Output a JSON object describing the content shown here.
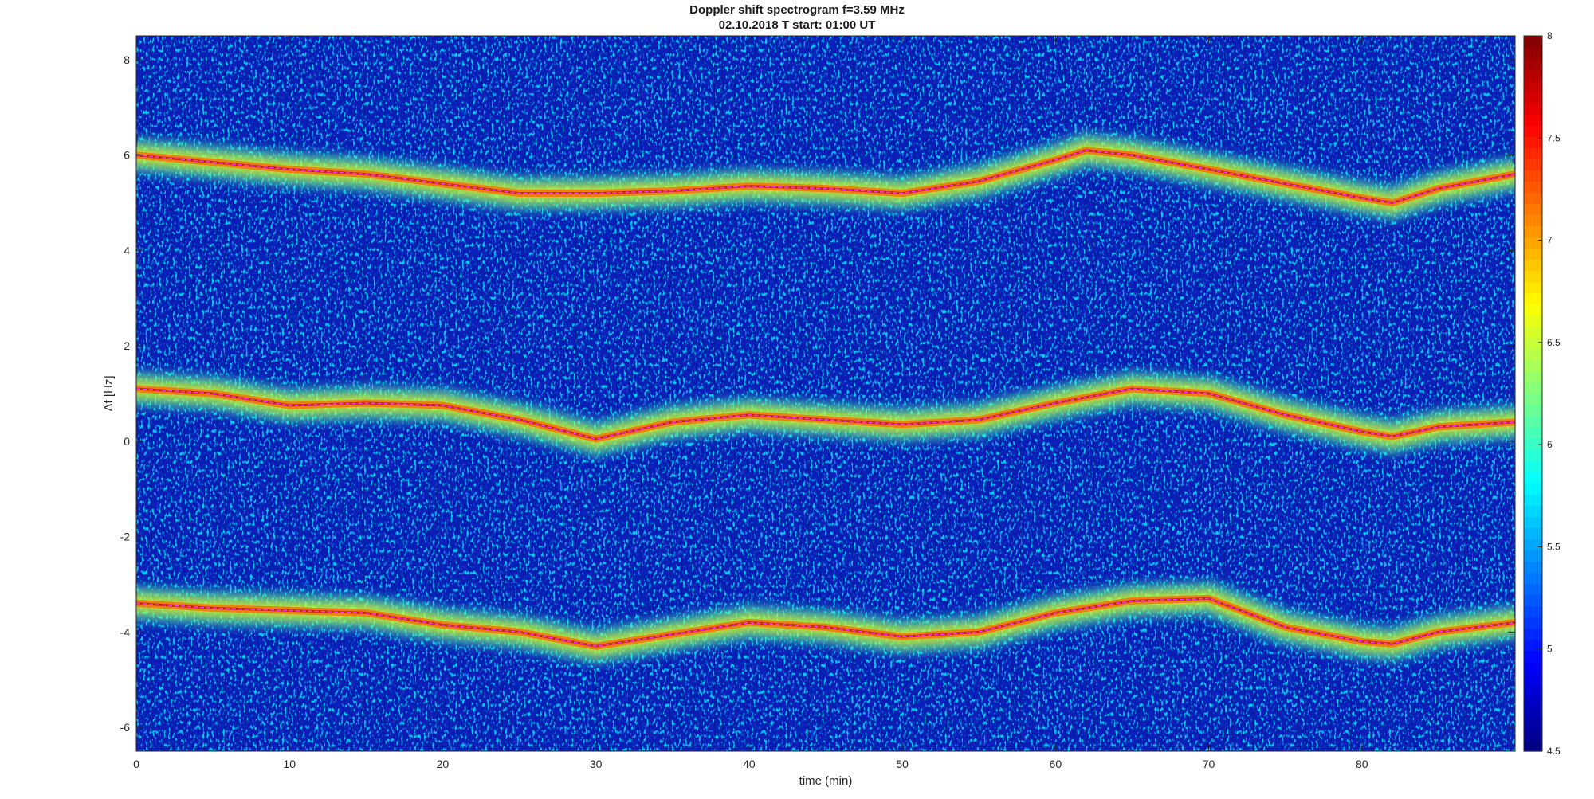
{
  "chart_data": {
    "type": "heatmap",
    "title": "Doppler shift spectrogram f=3.59 MHz",
    "subtitle": "02.10.2018   T start: 01:00 UT",
    "xlabel": "time (min)",
    "ylabel": "Δf [Hz]",
    "xlim": [
      0,
      90
    ],
    "ylim": [
      -6.5,
      8.5
    ],
    "xticks": [
      0,
      10,
      20,
      30,
      40,
      50,
      60,
      70,
      80
    ],
    "yticks": [
      -6,
      -4,
      -2,
      0,
      2,
      4,
      6,
      8
    ],
    "colormap": "jet",
    "clim": [
      4.5,
      8
    ],
    "colorbar_ticks": [
      4.5,
      5,
      5.5,
      6,
      6.5,
      7,
      7.5,
      8
    ],
    "grid": false,
    "traces": [
      {
        "name": "",
        "color": "#ff33ff",
        "x": [
          0,
          5,
          10,
          15,
          20,
          25,
          30,
          35,
          40,
          45,
          50,
          55,
          60,
          62,
          65,
          70,
          75,
          80,
          82,
          85,
          90
        ],
        "y": [
          6.0,
          5.85,
          5.7,
          5.6,
          5.4,
          5.2,
          5.2,
          5.25,
          5.35,
          5.3,
          5.2,
          5.45,
          5.9,
          6.1,
          6.0,
          5.7,
          5.4,
          5.1,
          5.0,
          5.3,
          5.6
        ]
      },
      {
        "name": "",
        "color": "#ff33ff",
        "x": [
          0,
          5,
          10,
          15,
          20,
          25,
          30,
          35,
          40,
          45,
          50,
          55,
          60,
          65,
          70,
          75,
          80,
          82,
          85,
          90
        ],
        "y": [
          1.1,
          1.0,
          0.75,
          0.8,
          0.75,
          0.45,
          0.05,
          0.4,
          0.55,
          0.45,
          0.35,
          0.45,
          0.8,
          1.1,
          1.0,
          0.55,
          0.2,
          0.1,
          0.3,
          0.4
        ]
      },
      {
        "name": "",
        "color": "#ff33ff",
        "x": [
          0,
          5,
          10,
          15,
          20,
          25,
          30,
          35,
          40,
          45,
          50,
          55,
          60,
          65,
          70,
          75,
          80,
          82,
          85,
          90
        ],
        "y": [
          -3.4,
          -3.5,
          -3.55,
          -3.6,
          -3.85,
          -4.0,
          -4.3,
          -4.05,
          -3.8,
          -3.9,
          -4.1,
          -4.0,
          -3.6,
          -3.35,
          -3.3,
          -3.9,
          -4.2,
          -4.25,
          -4.0,
          -3.8
        ]
      }
    ]
  }
}
